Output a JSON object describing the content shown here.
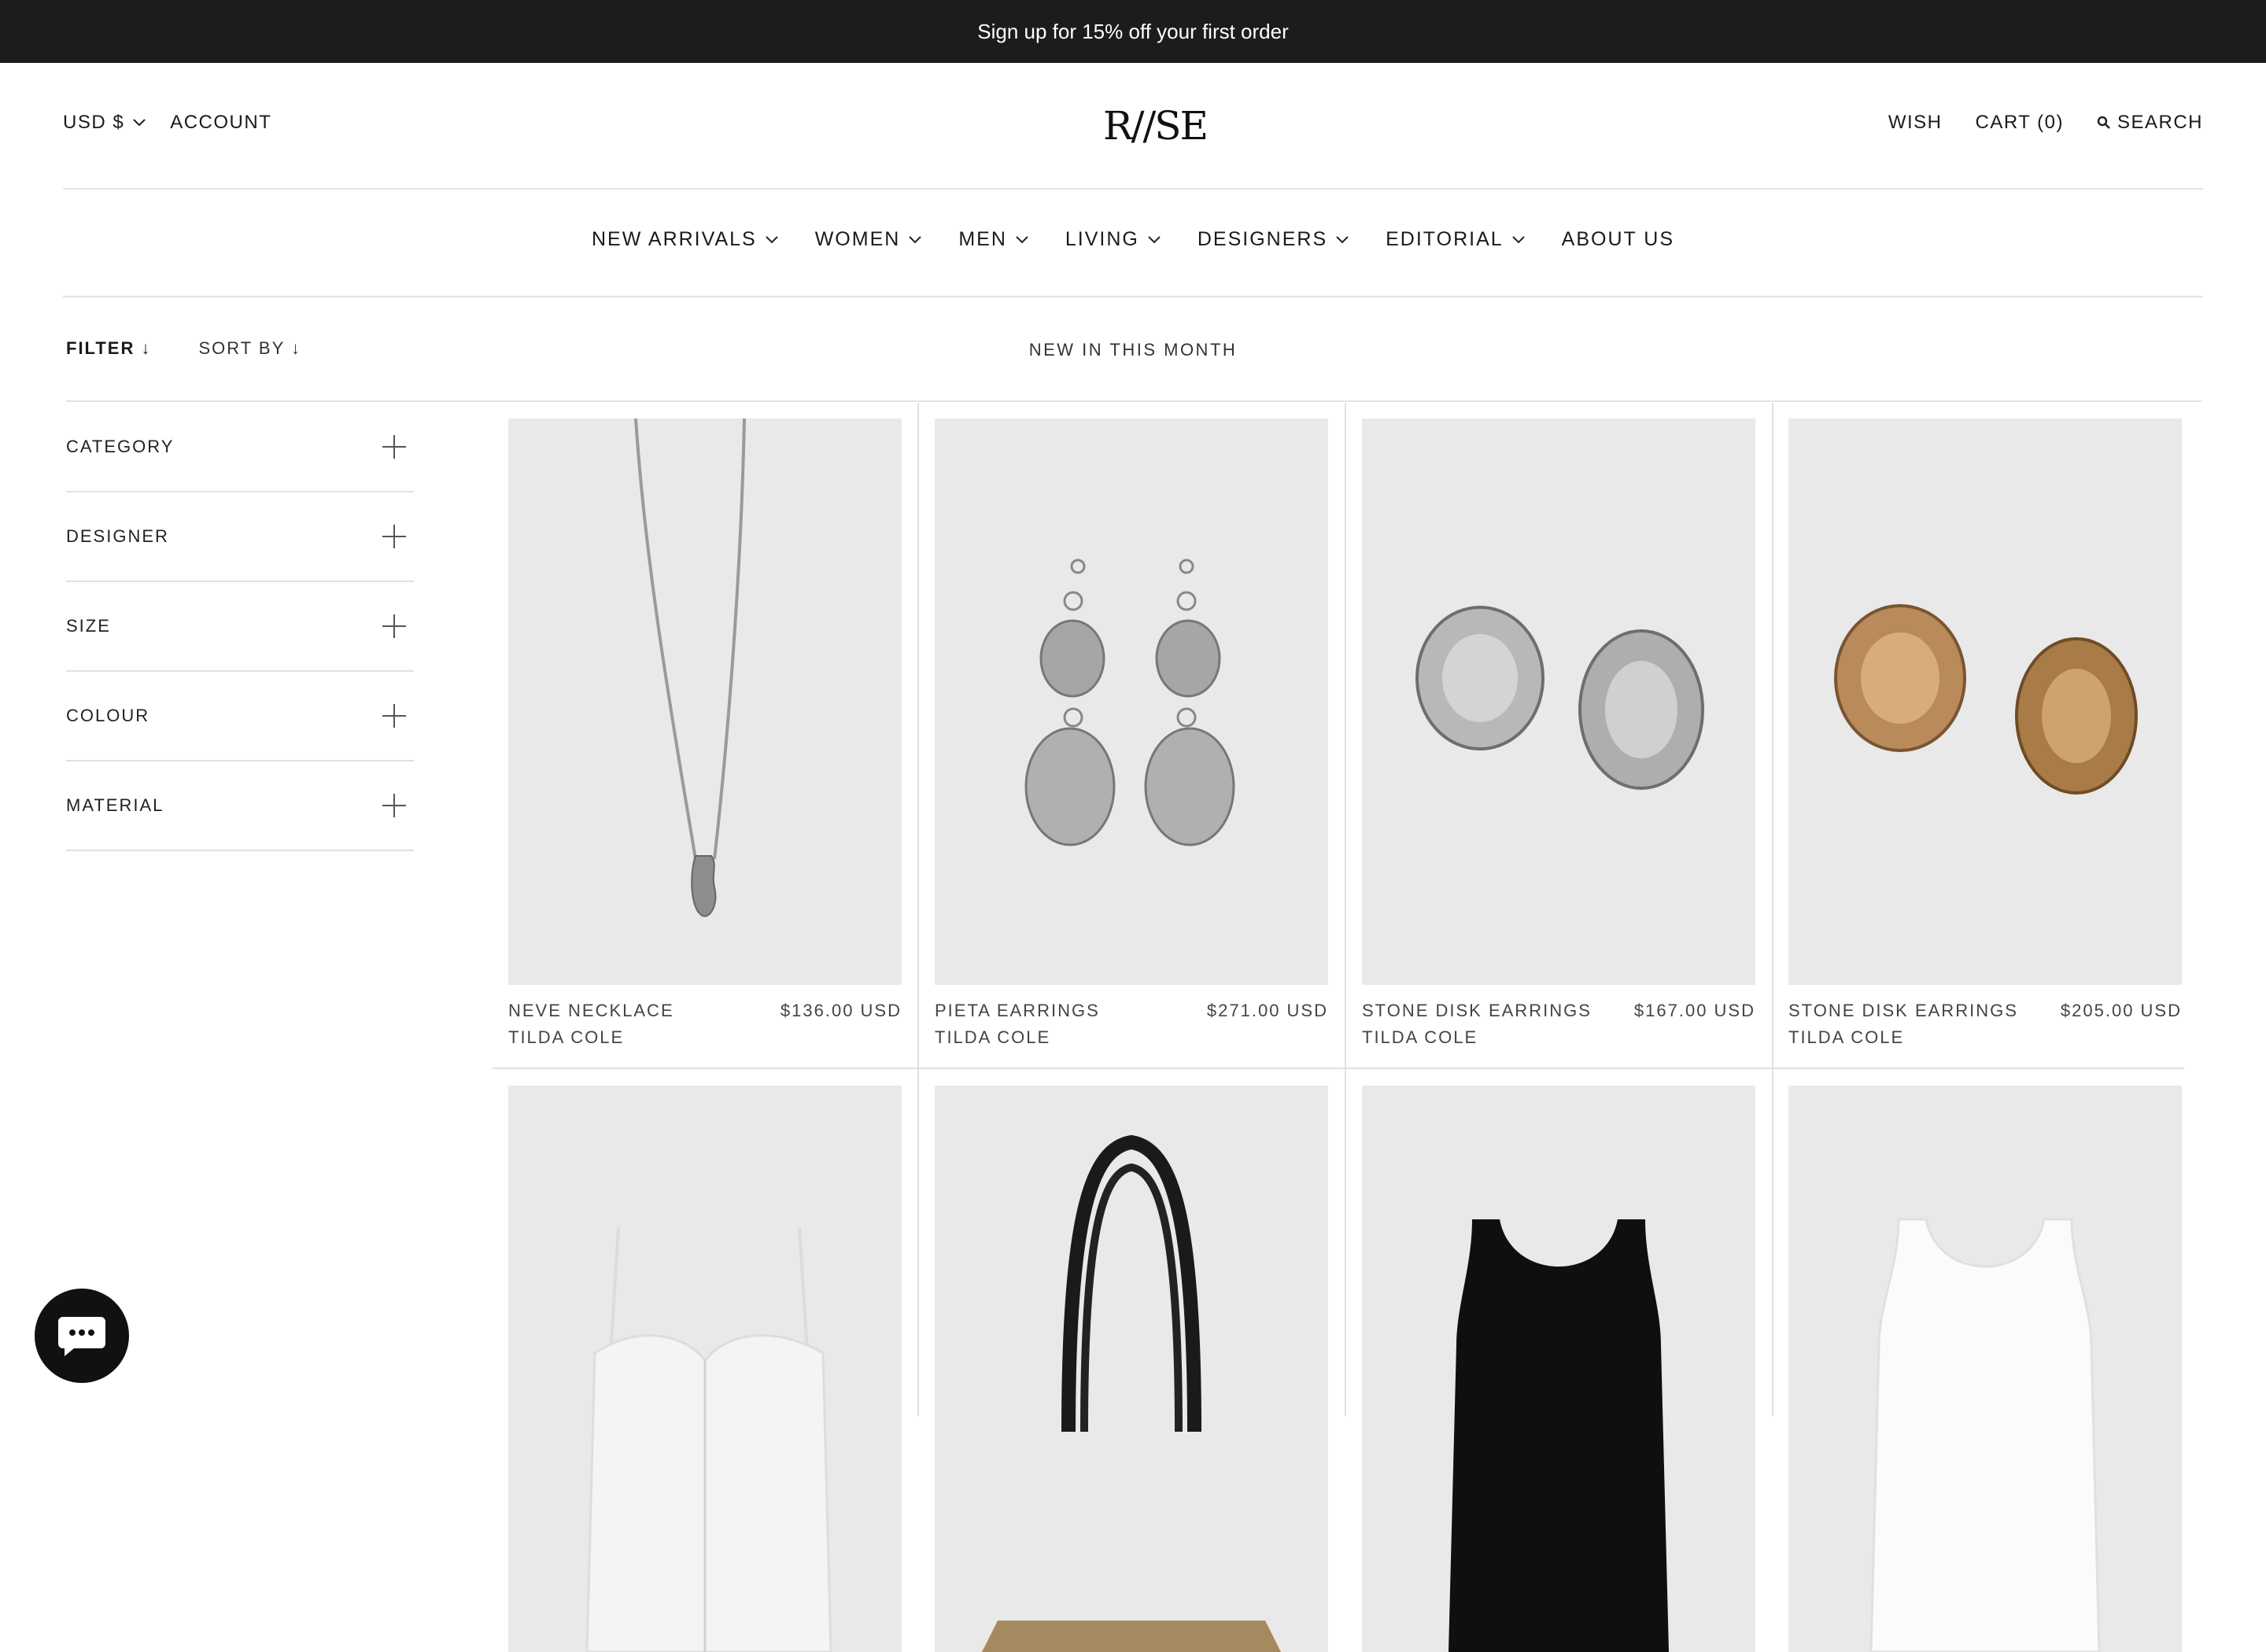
{
  "announcement": "Sign up for 15% off your first order",
  "header": {
    "currency": "USD $",
    "account": "ACCOUNT",
    "logo": "R//SE",
    "wish": "WISH",
    "cart": "CART (0)",
    "search": "SEARCH"
  },
  "nav": [
    {
      "label": "NEW ARRIVALS"
    },
    {
      "label": "WOMEN"
    },
    {
      "label": "MEN"
    },
    {
      "label": "LIVING"
    },
    {
      "label": "DESIGNERS"
    },
    {
      "label": "EDITORIAL"
    },
    {
      "label": "ABOUT US"
    }
  ],
  "toolbar": {
    "filter": "FILTER ↓",
    "sort": "SORT BY ↓",
    "title": "NEW IN THIS MONTH"
  },
  "facets": [
    "CATEGORY",
    "DESIGNER",
    "SIZE",
    "COLOUR",
    "MATERIAL"
  ],
  "products": [
    {
      "name": "NEVE NECKLACE",
      "price": "$136.00 USD",
      "designer": "TILDA COLE",
      "image": "silver-pendant-necklace"
    },
    {
      "name": "PIETA EARRINGS",
      "price": "$271.00 USD",
      "designer": "TILDA COLE",
      "image": "silver-drop-earrings"
    },
    {
      "name": "STONE DISK EARRINGS",
      "price": "$167.00 USD",
      "designer": "TILDA COLE",
      "image": "silver-disk-earrings"
    },
    {
      "name": "STONE DISK EARRINGS",
      "price": "$205.00 USD",
      "designer": "TILDA COLE",
      "image": "gold-disk-earrings"
    },
    {
      "image": "white-cami-top"
    },
    {
      "image": "black-woven-tote"
    },
    {
      "image": "black-tank-top"
    },
    {
      "image": "white-tank-top"
    }
  ],
  "colors": {
    "announcement_bg": "#1c1c1c",
    "image_bg": "#e9e9e9",
    "chat_bg": "#111111"
  }
}
